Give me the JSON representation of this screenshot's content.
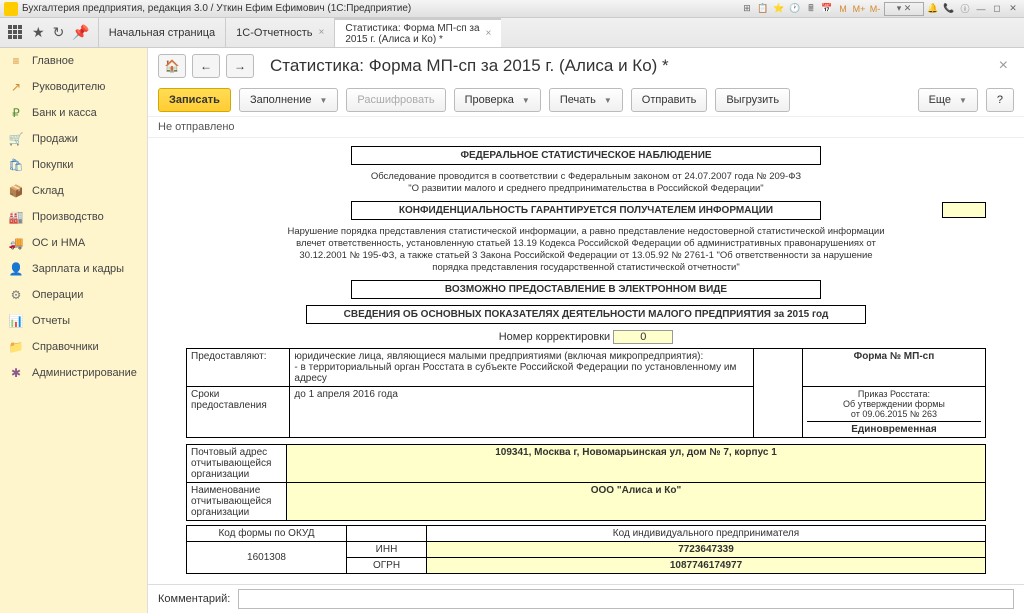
{
  "titlebar": {
    "text": "Бухгалтерия предприятия, редакция 3.0 / Уткин Ефим Ефимович   (1С:Предприятие)",
    "marks": [
      "M",
      "M+",
      "M-"
    ]
  },
  "tabs": {
    "items": [
      {
        "label": "Начальная страница"
      },
      {
        "label": "1С-Отчетность"
      },
      {
        "label_line1": "Статистика: Форма МП-сп за",
        "label_line2": "2015 г. (Алиса и Ко) *"
      }
    ]
  },
  "sidebar": {
    "items": [
      {
        "icon": "≡",
        "label": "Главное",
        "cls": "c-orange"
      },
      {
        "icon": "↗",
        "label": "Руководителю",
        "cls": "c-orange"
      },
      {
        "icon": "₽",
        "label": "Банк и касса",
        "cls": "c-green"
      },
      {
        "icon": "🛒",
        "label": "Продажи",
        "cls": "c-blue"
      },
      {
        "icon": "🛍",
        "label": "Покупки",
        "cls": "c-blue"
      },
      {
        "icon": "📦",
        "label": "Склад",
        "cls": "c-brown"
      },
      {
        "icon": "🏭",
        "label": "Производство",
        "cls": "c-gray"
      },
      {
        "icon": "🚚",
        "label": "ОС и НМА",
        "cls": "c-gray"
      },
      {
        "icon": "👤",
        "label": "Зарплата и кадры",
        "cls": "c-blue"
      },
      {
        "icon": "⚙",
        "label": "Операции",
        "cls": "c-gray"
      },
      {
        "icon": "📊",
        "label": "Отчеты",
        "cls": "c-blue"
      },
      {
        "icon": "📁",
        "label": "Справочники",
        "cls": "c-orange"
      },
      {
        "icon": "✱",
        "label": "Администрирование",
        "cls": "c-purple"
      }
    ]
  },
  "header": {
    "title": "Статистика: Форма МП-сп за 2015 г. (Алиса и Ко) *"
  },
  "toolbar": {
    "save": "Записать",
    "fill": "Заполнение",
    "decode": "Расшифровать",
    "check": "Проверка",
    "print": "Печать",
    "send": "Отправить",
    "export": "Выгрузить",
    "more": "Еще",
    "help": "?"
  },
  "status": "Не отправлено",
  "doc": {
    "header1": "ФЕДЕРАЛЬНОЕ СТАТИСТИЧЕСКОЕ НАБЛЮДЕНИЕ",
    "law_line1": "Обследование проводится в соответствии с Федеральным законом от 24.07.2007 года № 209-ФЗ",
    "law_line2": "\"О развитии малого и среднего предпринимательства в Российской Федерации\"",
    "conf": "КОНФИДЕНЦИАЛЬНОСТЬ ГАРАНТИРУЕТСЯ ПОЛУЧАТЕЛЕМ ИНФОРМАЦИИ",
    "violation": "Нарушение порядка представления статистической информации, а равно представление недостоверной статистической информации влечет ответственность, установленную статьей 13.19 Кодекса Российской Федерации об административных правонарушениях от 30.12.2001 № 195-ФЗ, а также статьей 3 Закона Российской Федерации от 13.05.92 № 2761-1 \"Об ответственности за нарушение порядка представления государственной статистической отчетности\"",
    "electronic": "ВОЗМОЖНО ПРЕДОСТАВЛЕНИЕ В ЭЛЕКТРОННОМ ВИДЕ",
    "info_title": "СВЕДЕНИЯ ОБ ОСНОВНЫХ ПОКАЗАТЕЛЯХ ДЕЯТЕЛЬНОСТИ МАЛОГО ПРЕДПРИЯТИЯ за 2015 год",
    "corr_label": "Номер корректировки",
    "corr_value": "0",
    "provide_label": "Предоставляют:",
    "provide_text": "юридические лица, являющиеся малыми предприятиями (включая микропредприятия):\n   - в территориальный орган Росстата в субъекте Российской Федерации по установленному им адресу",
    "deadline_label": "Сроки предоставления",
    "deadline_value": "до 1 апреля 2016 года",
    "form_no": "Форма № МП-сп",
    "order": "Приказ Росстата:\nОб утверждении формы\nот 09.06.2015 № 263",
    "once": "Единовременная",
    "address_label": "Почтовый адрес отчитывающейся организации",
    "address_value": "109341, Москва г, Новомарьинская ул, дом № 7, корпус 1",
    "name_label": "Наименование отчитывающейся организации",
    "name_value": "ООО \"Алиса и Ко\"",
    "okud_label": "Код формы по ОКУД",
    "ip_label": "Код индивидуального предпринимателя",
    "inn_label": "ИНН",
    "ogrn_label": "ОГРН",
    "okud_value": "1601308",
    "inn_value": "7723647339",
    "ogrn_value": "1087746174977"
  },
  "comment_label": "Комментарий:"
}
